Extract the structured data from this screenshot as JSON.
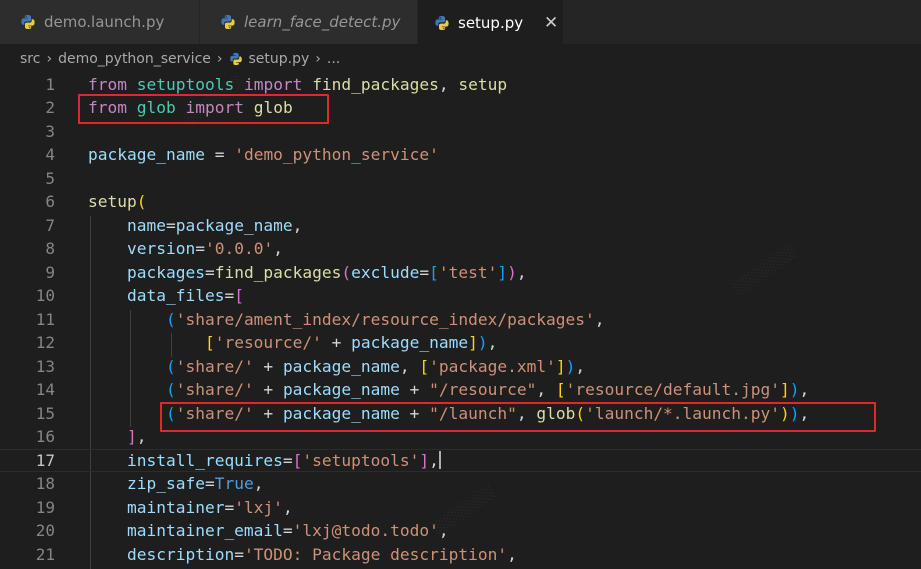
{
  "tabs": [
    {
      "label": "demo.launch.py",
      "italic": false,
      "active": false,
      "icon": "python-file-icon"
    },
    {
      "label": "learn_face_detect.py",
      "italic": true,
      "active": false,
      "icon": "python-file-icon"
    },
    {
      "label": "setup.py",
      "italic": false,
      "active": true,
      "icon": "python-file-icon",
      "close": "✕"
    }
  ],
  "breadcrumb": {
    "items": [
      "src",
      "demo_python_service",
      "setup.py",
      "..."
    ],
    "separator": "›"
  },
  "editor": {
    "cursor_line": 17,
    "lines": [
      {
        "num": "1",
        "tokens": [
          [
            "from",
            "kw"
          ],
          [
            " "
          ],
          [
            "setuptools",
            "mod"
          ],
          [
            " "
          ],
          [
            "import",
            "kw"
          ],
          [
            " "
          ],
          [
            "find_packages",
            "fn"
          ],
          [
            ", "
          ],
          [
            "setup",
            "fn"
          ]
        ]
      },
      {
        "num": "2",
        "tokens": [
          [
            "from",
            "kw"
          ],
          [
            " "
          ],
          [
            "glob",
            "mod"
          ],
          [
            " "
          ],
          [
            "import",
            "kw"
          ],
          [
            " "
          ],
          [
            "glob",
            "fn"
          ]
        ]
      },
      {
        "num": "3",
        "tokens": []
      },
      {
        "num": "4",
        "tokens": [
          [
            "package_name",
            "var"
          ],
          [
            " = "
          ],
          [
            "'demo_python_service'",
            "str"
          ]
        ]
      },
      {
        "num": "5",
        "tokens": []
      },
      {
        "num": "6",
        "tokens": [
          [
            "setup",
            "fn"
          ],
          [
            "(",
            "p1"
          ]
        ]
      },
      {
        "num": "7",
        "tokens": [
          [
            "    "
          ],
          [
            "name",
            "var"
          ],
          [
            "="
          ],
          [
            "package_name",
            "var"
          ],
          [
            ","
          ]
        ]
      },
      {
        "num": "8",
        "tokens": [
          [
            "    "
          ],
          [
            "version",
            "var"
          ],
          [
            "="
          ],
          [
            "'0.0.0'",
            "str"
          ],
          [
            ","
          ]
        ]
      },
      {
        "num": "9",
        "tokens": [
          [
            "    "
          ],
          [
            "packages",
            "var"
          ],
          [
            "="
          ],
          [
            "find_packages",
            "fn"
          ],
          [
            "(",
            "p2"
          ],
          [
            "exclude",
            "var"
          ],
          [
            "="
          ],
          [
            "[",
            "p3"
          ],
          [
            "'test'",
            "str"
          ],
          [
            "]",
            "p3"
          ],
          [
            ")",
            "p2"
          ],
          [
            ","
          ]
        ]
      },
      {
        "num": "10",
        "tokens": [
          [
            "    "
          ],
          [
            "data_files",
            "var"
          ],
          [
            "="
          ],
          [
            "[",
            "p2"
          ]
        ]
      },
      {
        "num": "11",
        "tokens": [
          [
            "        "
          ],
          [
            "(",
            "p3"
          ],
          [
            "'share/ament_index/resource_index/packages'",
            "str"
          ],
          [
            ","
          ]
        ]
      },
      {
        "num": "12",
        "tokens": [
          [
            "            "
          ],
          [
            "[",
            "p1"
          ],
          [
            "'resource/'",
            "str"
          ],
          [
            " + "
          ],
          [
            "package_name",
            "var"
          ],
          [
            "]",
            "p1"
          ],
          [
            ")",
            "p3"
          ],
          [
            ","
          ]
        ]
      },
      {
        "num": "13",
        "tokens": [
          [
            "        "
          ],
          [
            "(",
            "p3"
          ],
          [
            "'share/'",
            "str"
          ],
          [
            " + "
          ],
          [
            "package_name",
            "var"
          ],
          [
            ", "
          ],
          [
            "[",
            "p1"
          ],
          [
            "'package.xml'",
            "str"
          ],
          [
            "]",
            "p1"
          ],
          [
            ")",
            "p3"
          ],
          [
            ","
          ]
        ]
      },
      {
        "num": "14",
        "tokens": [
          [
            "        "
          ],
          [
            "(",
            "p3"
          ],
          [
            "'share/'",
            "str"
          ],
          [
            " + "
          ],
          [
            "package_name",
            "var"
          ],
          [
            " + "
          ],
          [
            "\"/resource\"",
            "str"
          ],
          [
            ", "
          ],
          [
            "[",
            "p1"
          ],
          [
            "'resource/default.jpg'",
            "str"
          ],
          [
            "]",
            "p1"
          ],
          [
            ")",
            "p3"
          ],
          [
            ","
          ]
        ]
      },
      {
        "num": "15",
        "tokens": [
          [
            "        "
          ],
          [
            "(",
            "p3"
          ],
          [
            "'share/'",
            "str"
          ],
          [
            " + "
          ],
          [
            "package_name",
            "var"
          ],
          [
            " + "
          ],
          [
            "\"/launch\"",
            "str"
          ],
          [
            ", "
          ],
          [
            "glob",
            "fn"
          ],
          [
            "(",
            "p1"
          ],
          [
            "'launch/*.launch.py'",
            "str"
          ],
          [
            ")",
            "p1"
          ],
          [
            ")",
            "p3"
          ],
          [
            ","
          ]
        ]
      },
      {
        "num": "16",
        "tokens": [
          [
            "    "
          ],
          [
            "]",
            "p2"
          ],
          [
            ","
          ]
        ]
      },
      {
        "num": "17",
        "tokens": [
          [
            "    "
          ],
          [
            "install_requires",
            "var"
          ],
          [
            "="
          ],
          [
            "[",
            "p2"
          ],
          [
            "'setuptools'",
            "str"
          ],
          [
            "]",
            "p2"
          ],
          [
            ","
          ]
        ]
      },
      {
        "num": "18",
        "tokens": [
          [
            "    "
          ],
          [
            "zip_safe",
            "var"
          ],
          [
            "="
          ],
          [
            "True",
            "const"
          ],
          [
            ","
          ]
        ]
      },
      {
        "num": "19",
        "tokens": [
          [
            "    "
          ],
          [
            "maintainer",
            "var"
          ],
          [
            "="
          ],
          [
            "'lxj'",
            "str"
          ],
          [
            ","
          ]
        ]
      },
      {
        "num": "20",
        "tokens": [
          [
            "    "
          ],
          [
            "maintainer_email",
            "var"
          ],
          [
            "="
          ],
          [
            "'lxj@todo.todo'",
            "str"
          ],
          [
            ","
          ]
        ]
      },
      {
        "num": "21",
        "tokens": [
          [
            "    "
          ],
          [
            "description",
            "var"
          ],
          [
            "="
          ],
          [
            "'TODO: Package description'",
            "str"
          ],
          [
            ","
          ]
        ]
      }
    ]
  },
  "colors": {
    "editor_bg": "#1e1e1e",
    "highlight_box": "#e02a2a",
    "keyword": "#c586c0",
    "string": "#ce9178",
    "variable": "#9cdcfe",
    "function": "#dcdcaa"
  }
}
